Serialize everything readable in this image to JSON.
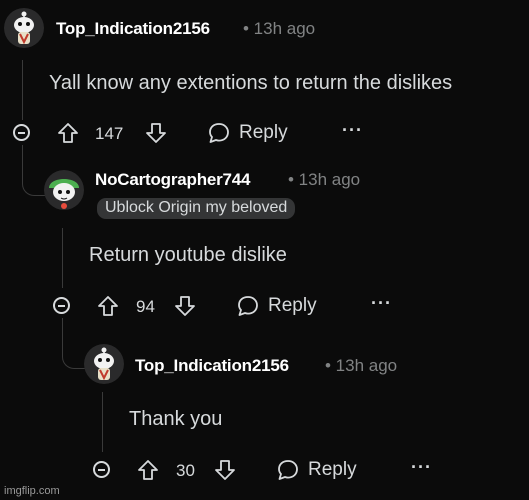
{
  "comments": [
    {
      "username": "Top_Indication2156",
      "time": "• 13h ago",
      "body": "Yall know any extentions to return the dislikes",
      "votes": "147",
      "reply_label": "Reply",
      "more_label": "···"
    },
    {
      "username": "NoCartographer744",
      "time": "• 13h ago",
      "flair": "Ublock Origin my beloved",
      "body": "Return youtube dislike",
      "votes": "94",
      "reply_label": "Reply",
      "more_label": "···"
    },
    {
      "username": "Top_Indication2156",
      "time": "• 13h ago",
      "body": "Thank you",
      "votes": "30",
      "reply_label": "Reply",
      "more_label": "···"
    }
  ],
  "watermark": "imgflip.com",
  "colors": {
    "background": "#0b0b0b",
    "text": "#d7dadc",
    "muted": "#818384",
    "flair_bg": "#343536"
  }
}
